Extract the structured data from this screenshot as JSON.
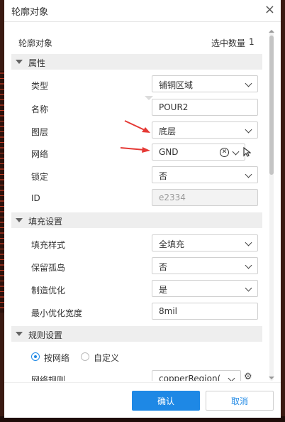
{
  "dialog": {
    "title": "轮廓对象"
  },
  "object": {
    "label": "轮廓对象",
    "count_label": "选中数量",
    "count": "1"
  },
  "sections": {
    "attributes": "属性",
    "fill": "填充设置",
    "rules": "规则设置"
  },
  "attributes": {
    "type_label": "类型",
    "type_value": "铺铜区域",
    "name_label": "名称",
    "name_value": "POUR2",
    "layer_label": "图层",
    "layer_value": "底层",
    "net_label": "网络",
    "net_value": "GND",
    "lock_label": "锁定",
    "lock_value": "否",
    "id_label": "ID",
    "id_value": "e2334"
  },
  "fill": {
    "style_label": "填充样式",
    "style_value": "全填充",
    "island_label": "保留孤岛",
    "island_value": "否",
    "opt_label": "制造优化",
    "opt_value": "是",
    "min_width_label": "最小优化宽度",
    "min_width_value": "8mil"
  },
  "rules": {
    "by_net": "按网络",
    "custom": "自定义",
    "net_rule_label": "网络规则",
    "net_rule_value": "copperRegion("
  },
  "buttons": {
    "ok": "确认",
    "cancel": "取消"
  },
  "colors": {
    "accent": "#1e88e5",
    "annotation_arrow": "#e53935"
  }
}
